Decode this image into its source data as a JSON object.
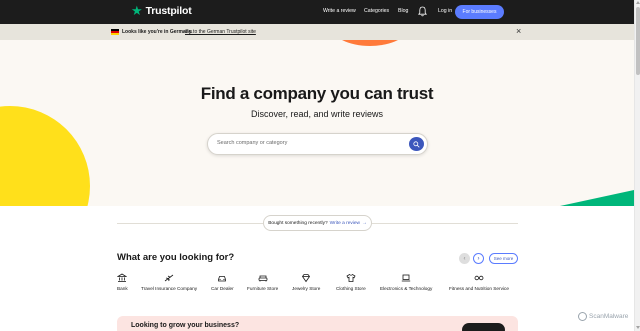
{
  "nav": {
    "logo_text": "Trustpilot",
    "links": [
      "Write a review",
      "Categories",
      "Blog"
    ],
    "bell_icon": "bell-icon",
    "login_label": "Log in",
    "business_button_label": "For businesses"
  },
  "banner": {
    "flag_icon": "germany-flag-icon",
    "bold_text": "Looks like you're in Germany.",
    "link_text": "Go to the German Trustpilot site",
    "close_icon": "close-icon"
  },
  "hero": {
    "title": "Find a company you can trust",
    "subtitle": "Discover, read, and write reviews",
    "search_placeholder": "Search company or category",
    "search_value": "",
    "search_icon": "search-icon"
  },
  "bought_pill": {
    "prefix": "Bought something recently?",
    "link": "Write a review",
    "arrow": "→"
  },
  "categories_section": {
    "title": "What are you looking for?",
    "prev_arrow": "‹",
    "next_arrow": "›",
    "see_more_label": "See more",
    "items": [
      {
        "label": "Bank",
        "icon": "bank-icon"
      },
      {
        "label": "Travel Insurance Company",
        "icon": "airplane-icon"
      },
      {
        "label": "Car Dealer",
        "icon": "car-icon"
      },
      {
        "label": "Furniture Store",
        "icon": "sofa-icon"
      },
      {
        "label": "Jewelry Store",
        "icon": "diamond-icon"
      },
      {
        "label": "Clothing Store",
        "icon": "shirt-icon"
      },
      {
        "label": "Electronics & Technology",
        "icon": "laptop-icon"
      },
      {
        "label": "Fitness and Nutrition Service",
        "icon": "dumbbell-icon"
      }
    ]
  },
  "promo": {
    "text": "Looking to grow your business?"
  },
  "watermark": {
    "text": "ScanMalware"
  },
  "colors": {
    "nav_bg": "#1c1c1c",
    "brand_green": "#00b67a",
    "accent_blue": "#5b7cff",
    "link_blue": "#3c57bc",
    "hero_bg": "#fbf8f3",
    "banner_bg": "#e7e4dc",
    "deco_orange": "#ff7a3a",
    "deco_yellow": "#ffe01b",
    "promo_bg": "#fce4e1"
  }
}
